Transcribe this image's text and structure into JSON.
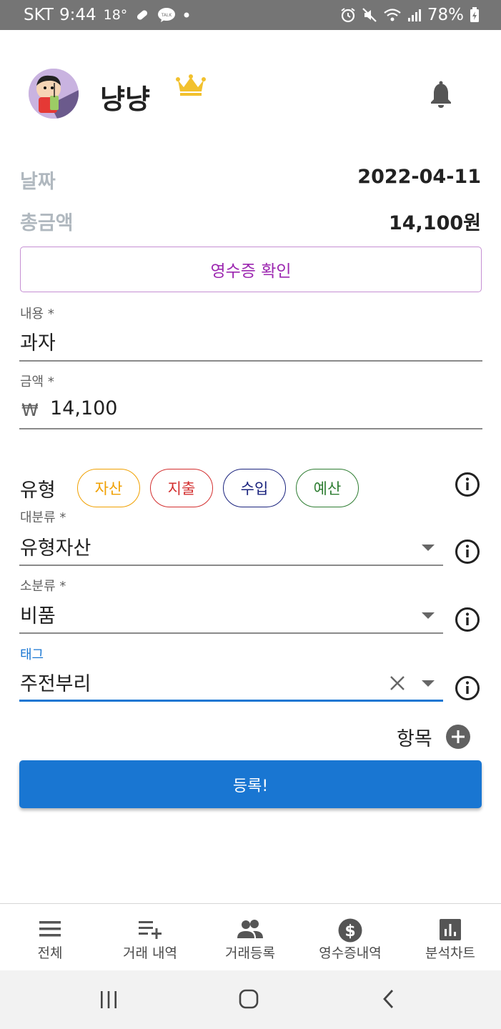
{
  "status_bar": {
    "carrier": "SKT",
    "time": "9:44",
    "temperature": "18°",
    "battery": "78%"
  },
  "header": {
    "username": "냥냥"
  },
  "summary": {
    "date_label": "날짜",
    "date_value": "2022-04-11",
    "total_label": "총금액",
    "total_value": "14,100원"
  },
  "receipt_button": "영수증 확인",
  "form": {
    "content_label": "내용 *",
    "content_value": "과자",
    "amount_label": "금액 *",
    "currency_symbol": "₩",
    "amount_value": "14,100",
    "type_label": "유형",
    "type_chips": [
      {
        "label": "자산",
        "color": "#f0a000"
      },
      {
        "label": "지출",
        "color": "#d32f2f"
      },
      {
        "label": "수입",
        "color": "#1a237e"
      },
      {
        "label": "예산",
        "color": "#2e7d32"
      }
    ],
    "major_label": "대분류 *",
    "major_value": "유형자산",
    "minor_label": "소분류 *",
    "minor_value": "비품",
    "tag_label": "태그",
    "tag_value": "주전부리",
    "add_item_label": "항목"
  },
  "submit_button": "등록!",
  "bottom_nav": [
    {
      "label": "전체",
      "icon": "menu-icon"
    },
    {
      "label": "거래 내역",
      "icon": "playlist-add-icon"
    },
    {
      "label": "거래등록",
      "icon": "people-icon"
    },
    {
      "label": "영수증내역",
      "icon": "dollar-icon"
    },
    {
      "label": "분석차트",
      "icon": "bar-chart-icon"
    }
  ],
  "colors": {
    "primary": "#1976d2",
    "receipt_purple": "#9c27b0",
    "crown": "#f2c12e"
  }
}
